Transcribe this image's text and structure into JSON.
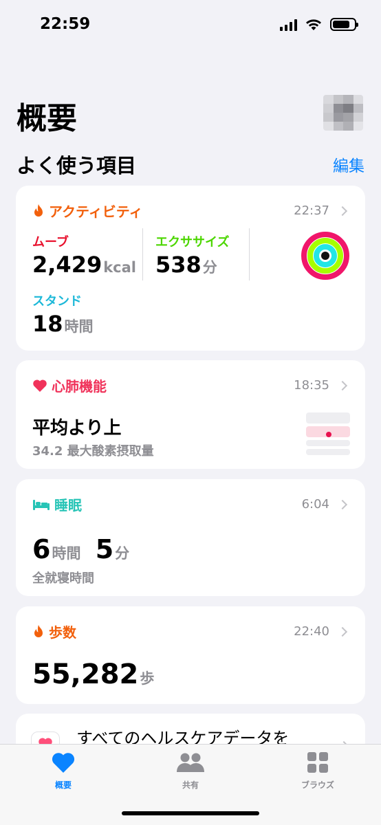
{
  "status_bar": {
    "time": "22:59",
    "battery_level": 0.8
  },
  "header": {
    "title": "概要"
  },
  "favorites": {
    "title": "よく使う項目",
    "edit_label": "編集"
  },
  "colors": {
    "activity": "#f2600c",
    "move": "#e8112d",
    "exercise": "#4cd600",
    "stand": "#1cb8d8",
    "heart": "#f0325a",
    "sleep": "#27c4b6",
    "accent": "#0a84ff",
    "secondary": "#8e8e93"
  },
  "activity": {
    "title": "アクティビティ",
    "time": "22:37",
    "move": {
      "label": "ムーブ",
      "value": "2,429",
      "unit": "kcal"
    },
    "exercise": {
      "label": "エクササイズ",
      "value": "538",
      "unit": "分"
    },
    "stand": {
      "label": "スタンド",
      "value": "18",
      "unit": "時間"
    }
  },
  "cardio": {
    "title": "心肺機能",
    "time": "18:35",
    "status": "平均より上",
    "detail": "34.2 最大酸素摂取量"
  },
  "sleep": {
    "title": "睡眠",
    "time": "6:04",
    "hours_value": "6",
    "hours_unit": "時間",
    "minutes_value": "5",
    "minutes_unit": "分",
    "caption": "全就寝時間"
  },
  "steps": {
    "title": "歩数",
    "time": "22:40",
    "value": "55,282",
    "unit": "歩"
  },
  "all_data": {
    "label": "すべてのヘルスケアデータを"
  },
  "tabbar": {
    "tabs": [
      {
        "label": "概要",
        "icon": "heart-icon",
        "active": true
      },
      {
        "label": "共有",
        "icon": "people-icon",
        "active": false
      },
      {
        "label": "ブラウズ",
        "icon": "grid-icon",
        "active": false
      }
    ]
  }
}
